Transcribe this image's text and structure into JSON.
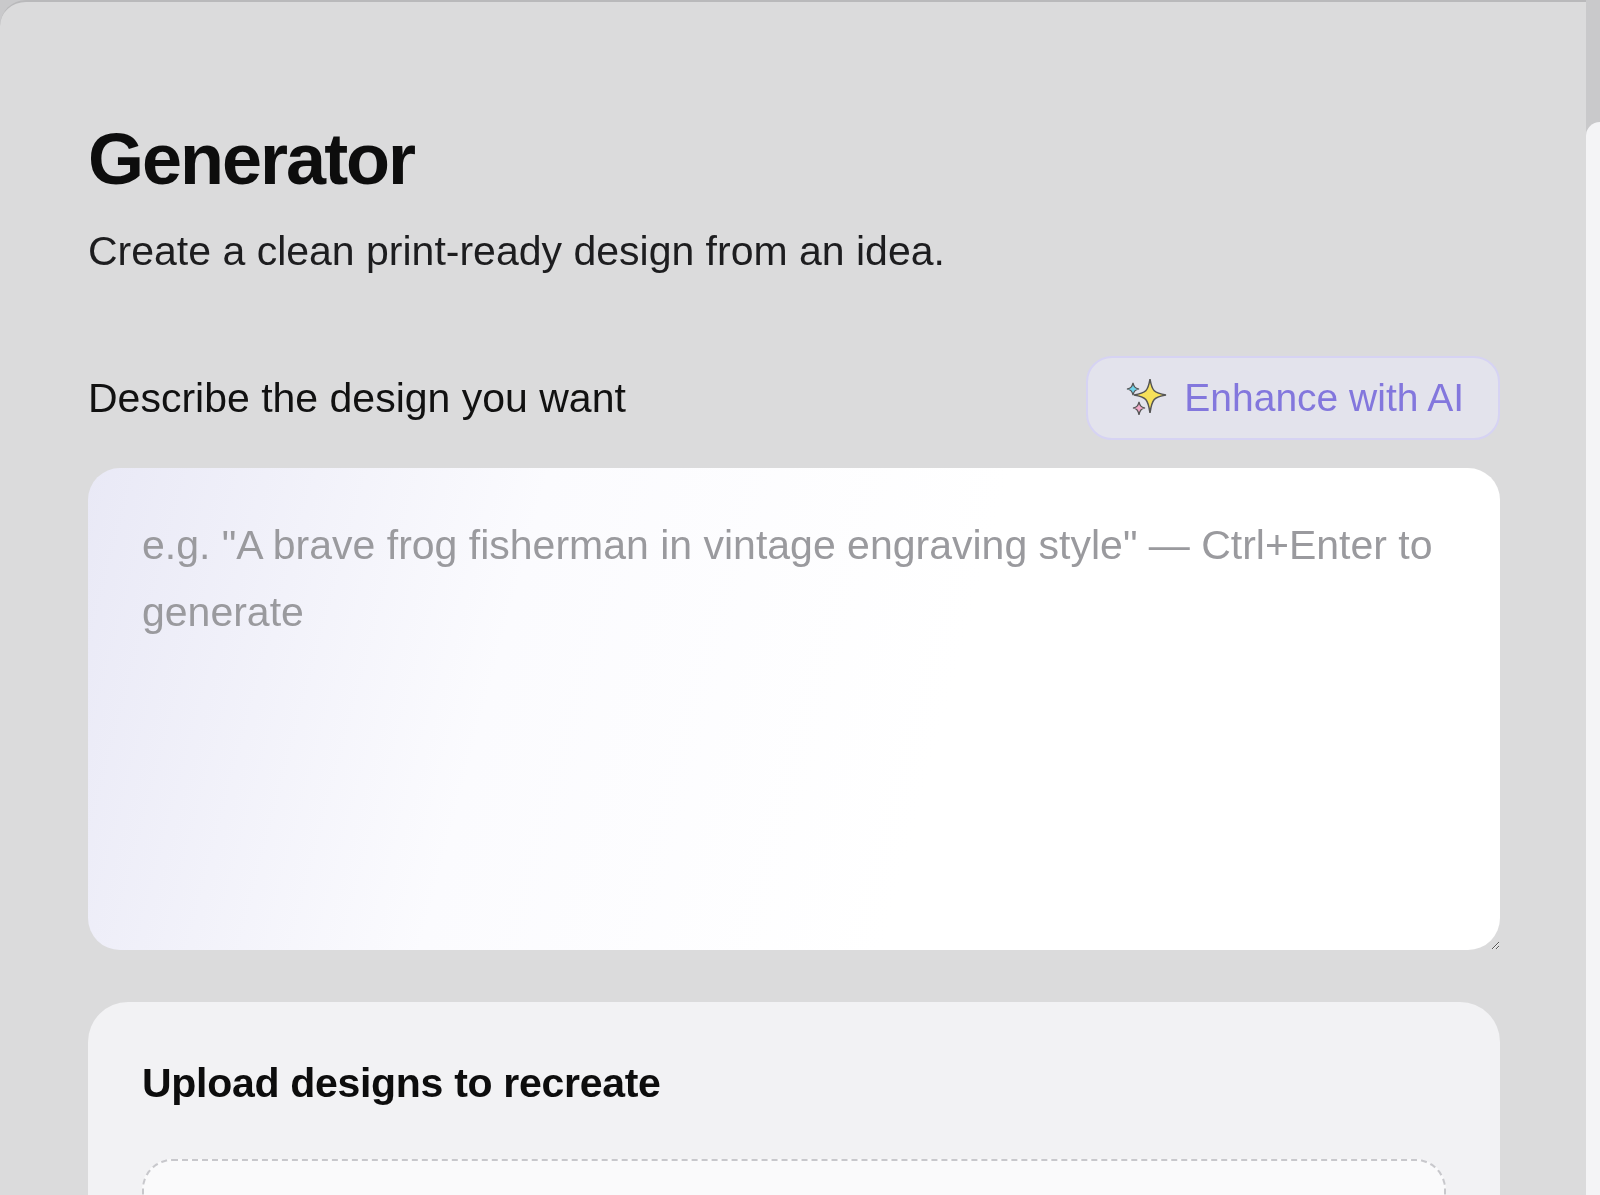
{
  "header": {
    "title": "Generator",
    "subtitle": "Create a clean print-ready design from an idea."
  },
  "prompt": {
    "label": "Describe the design you want",
    "enhance_button": "Enhance with AI",
    "placeholder": "e.g. \"A brave frog fisherman in vintage engraving style\" — Ctrl+Enter to generate"
  },
  "upload": {
    "title": "Upload designs to recreate"
  }
}
